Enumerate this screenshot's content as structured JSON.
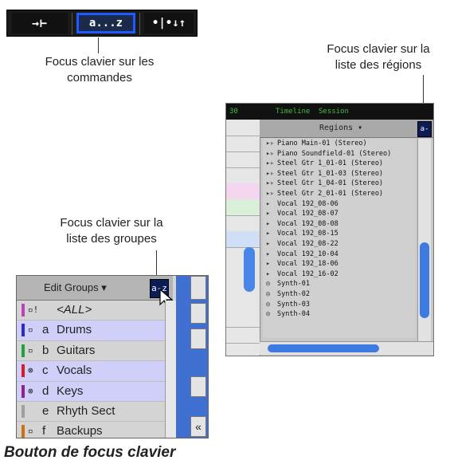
{
  "toolbar": {
    "buttons": [
      {
        "label": "→⊢",
        "icon": "nudge-right-icon"
      },
      {
        "label": "a...z",
        "icon": "keyboard-focus-commands-icon"
      },
      {
        "label": "•|•↓↑",
        "icon": "tab-to-transient-icon"
      }
    ],
    "focus_color": "#1f5bff"
  },
  "captions": {
    "commands": [
      "Focus clavier sur les",
      "commandes"
    ],
    "regions": [
      "Focus clavier sur la",
      "liste des régions"
    ],
    "groups": [
      "Focus clavier sur la",
      "liste des groupes"
    ],
    "bottom": "Bouton de focus clavier"
  },
  "regions_window": {
    "top_tabs": [
      "Timeline",
      "Session"
    ],
    "top_left": "30",
    "header": "Regions ▾",
    "focus_button_label": "a-z",
    "items": [
      {
        "icon": "▸▹",
        "name": "Piano Main-01 (Stereo)"
      },
      {
        "icon": "▸▹",
        "name": "Piano Soundfield-01 (Stereo)"
      },
      {
        "icon": "▸▹",
        "name": "Steel Gtr 1_01-01 (Stereo)"
      },
      {
        "icon": "▸▹",
        "name": "Steel Gtr 1_01-03 (Stereo)"
      },
      {
        "icon": "▸▹",
        "name": "Steel Gtr 1_04-01 (Stereo)"
      },
      {
        "icon": "▸▹",
        "name": "Steel Gtr 2_01-01 (Stereo)"
      },
      {
        "icon": "▸",
        "name": "Vocal 192_08-06"
      },
      {
        "icon": "▸",
        "name": "Vocal 192_08-07"
      },
      {
        "icon": "▸",
        "name": "Vocal 192_08-08"
      },
      {
        "icon": "▸",
        "name": "Vocal 192_08-15"
      },
      {
        "icon": "▸",
        "name": "Vocal 192_08-22"
      },
      {
        "icon": "▸",
        "name": "Vocal 192_10-04"
      },
      {
        "icon": "▸",
        "name": "Vocal 192_18-06"
      },
      {
        "icon": "▸",
        "name": "Vocal 192_16-02"
      },
      {
        "icon": "◎",
        "name": "Synth-01"
      },
      {
        "icon": "◎",
        "name": "Synth-02"
      },
      {
        "icon": "◎",
        "name": "Synth-03"
      },
      {
        "icon": "◎",
        "name": "Synth-04"
      }
    ]
  },
  "groups_window": {
    "header": "Edit Groups ▾",
    "focus_button_label": "a-z",
    "items": [
      {
        "mark": "▫!",
        "letter": "",
        "name": "<ALL>",
        "color": "#c040c0",
        "selected": false,
        "italic": true
      },
      {
        "mark": "▫",
        "letter": "a",
        "name": "Drums",
        "color": "#2a2ad0",
        "selected": true
      },
      {
        "mark": "▫",
        "letter": "b",
        "name": "Guitars",
        "color": "#20a040",
        "selected": false
      },
      {
        "mark": "⊗",
        "letter": "c",
        "name": "Vocals",
        "color": "#d02020",
        "selected": true
      },
      {
        "mark": "⊗",
        "letter": "d",
        "name": "Keys",
        "color": "#902090",
        "selected": true
      },
      {
        "mark": "",
        "letter": "e",
        "name": "Rhyth Sect",
        "color": "#a0a0a0",
        "selected": false
      },
      {
        "mark": "▫",
        "letter": "f",
        "name": "Backups",
        "color": "#d07010",
        "selected": false
      }
    ],
    "scroll_left_label": "«"
  }
}
